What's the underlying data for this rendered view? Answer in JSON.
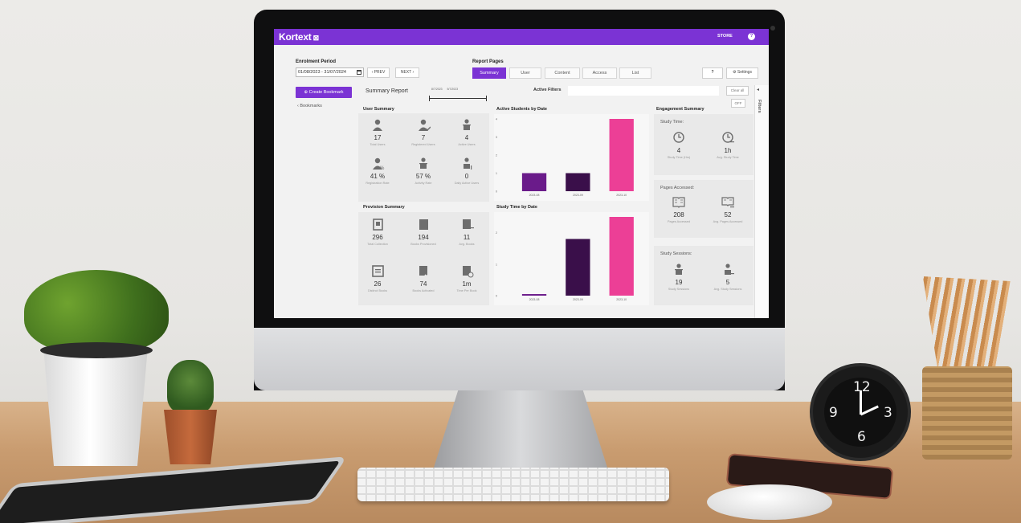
{
  "header": {
    "app_name": "Kortext",
    "store_label": "STORE",
    "help_label": "?"
  },
  "controls": {
    "enrolment_label": "Enrolment Period",
    "date_range": "01/08/2023 - 31/07/2024",
    "prev_label": "‹ PREV",
    "next_label": "NEXT ›",
    "report_pages_label": "Report Pages",
    "tabs": [
      {
        "label": "Summary",
        "active": true
      },
      {
        "label": "User",
        "active": false
      },
      {
        "label": "Content",
        "active": false
      },
      {
        "label": "Access",
        "active": false
      },
      {
        "label": "List",
        "active": false
      }
    ],
    "help_label": "?",
    "settings_label": "⚙ Settings"
  },
  "sidebar": {
    "create_bookmark": "⊕ Create Bookmark",
    "bookmarks_link": "‹ Bookmarks"
  },
  "report": {
    "title": "Summary Report",
    "slider_start": "8/7/2023",
    "slider_end": "5/7/2023",
    "active_filters_label": "Active Filters",
    "clear_all_label": "Clear all",
    "off_label": "OFF",
    "filters_side_label": "Filters",
    "collapse_arrow": "◂"
  },
  "user_summary": {
    "title": "User Summary",
    "stats": [
      {
        "icon": "user-icon",
        "value": "17",
        "label": "Total Users"
      },
      {
        "icon": "user-check-icon",
        "value": "7",
        "label": "Registered Users"
      },
      {
        "icon": "user-book-icon",
        "value": "4",
        "label": "Active Users"
      },
      {
        "icon": "user-percent-icon",
        "value": "41 %",
        "label": "Registration Rate"
      },
      {
        "icon": "user-book-icon",
        "value": "57 %",
        "label": "Activity Rate"
      },
      {
        "icon": "user-daily-icon",
        "value": "0",
        "label": "Daily Active Users"
      }
    ]
  },
  "provision_summary": {
    "title": "Provision Summary",
    "stats": [
      {
        "icon": "collection-icon",
        "value": "296",
        "label": "Total Collection"
      },
      {
        "icon": "book-icon",
        "value": "194",
        "label": "Books Provisioned"
      },
      {
        "icon": "book-avg-icon",
        "value": "11",
        "label": "Avg. Books"
      },
      {
        "icon": "distinct-books-icon",
        "value": "26",
        "label": "Distinct Books"
      },
      {
        "icon": "book-check-icon",
        "value": "74",
        "label": "Books Activated"
      },
      {
        "icon": "book-clock-icon",
        "value": "1m",
        "label": "Time Per Book"
      }
    ]
  },
  "engagement_summary": {
    "title": "Engagement Summary",
    "study_time_label": "Study Time:",
    "study_time_stats": [
      {
        "icon": "clock-icon",
        "value": "4",
        "label": "Study Time (Hrs)"
      },
      {
        "icon": "clock-avg-icon",
        "value": "1h",
        "label": "Avg. Study Time"
      }
    ],
    "pages_label": "Pages Accessed:",
    "pages_stats": [
      {
        "icon": "open-book-icon",
        "value": "208",
        "label": "Pages Accessed"
      },
      {
        "icon": "open-book-avg-icon",
        "value": "52",
        "label": "Avg. Pages Accessed"
      }
    ],
    "sessions_label": "Study Sessions:",
    "sessions_stats": [
      {
        "icon": "user-book-icon",
        "value": "19",
        "label": "Study Sessions"
      },
      {
        "icon": "user-book-avg-icon",
        "value": "5",
        "label": "Avg. Study Sessions"
      }
    ]
  },
  "colors": {
    "accent": "#7b33d4",
    "bar_purple": "#6a1b8a",
    "bar_dark": "#3a0f4a",
    "bar_pink": "#ec3f96"
  },
  "chart_data": [
    {
      "type": "bar",
      "title": "Active Students by Date",
      "categories": [
        "2023-08",
        "2023-09",
        "2023-10"
      ],
      "values": [
        1,
        1,
        4
      ],
      "bar_colors": [
        "#6a1b8a",
        "#3a0f4a",
        "#ec3f96"
      ],
      "ylim": [
        0,
        4
      ],
      "yticks": [
        "0",
        "1",
        "2",
        "3",
        "4"
      ]
    },
    {
      "type": "bar",
      "title": "Study Time by Date",
      "categories": [
        "2023-08",
        "2023-09",
        "2023-10"
      ],
      "values": [
        0.05,
        1.8,
        2.5
      ],
      "bar_colors": [
        "#6a1b8a",
        "#3a0f4a",
        "#ec3f96"
      ],
      "ylim": [
        0,
        2.5
      ],
      "yticks": [
        "0",
        "1",
        "2"
      ]
    }
  ]
}
